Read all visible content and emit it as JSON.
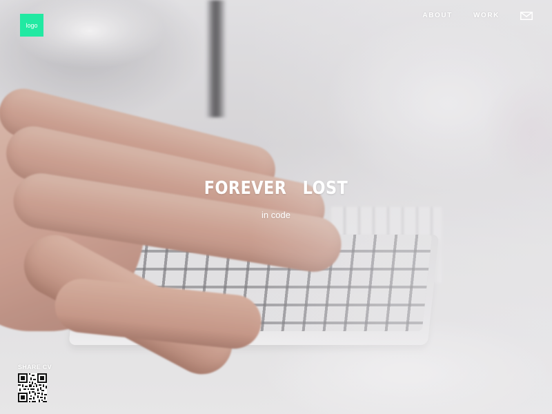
{
  "header": {
    "logo_text": "logo",
    "nav": [
      {
        "label": "ABOUT"
      },
      {
        "label": "WORK"
      }
    ],
    "mail_icon": "envelope-icon"
  },
  "hero": {
    "title": "FOREVER  LOST",
    "subtitle": "in code"
  },
  "share": {
    "label": "SHARE CV",
    "icon": "qr-code-icon"
  },
  "colors": {
    "logo_bg": "#21e9a2",
    "text": "#ffffff"
  }
}
